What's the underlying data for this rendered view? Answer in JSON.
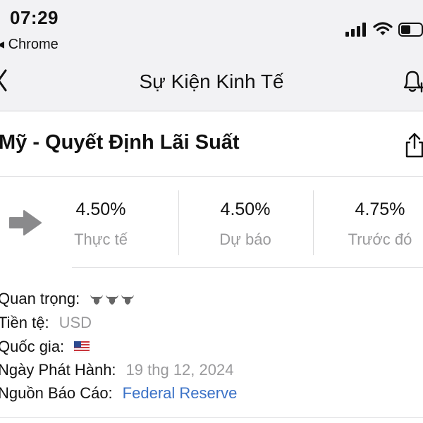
{
  "status_bar": {
    "time": "07:29",
    "back_app": "Chrome"
  },
  "nav": {
    "title": "Sự Kiện Kinh Tế"
  },
  "event": {
    "title": "Mỹ - Quyết Định Lãi Suất"
  },
  "values": {
    "actual": {
      "value": "4.50%",
      "label": "Thực tế"
    },
    "forecast": {
      "value": "4.50%",
      "label": "Dự báo"
    },
    "previous": {
      "value": "4.75%",
      "label": "Trước đó"
    }
  },
  "details": {
    "importance_label": "Quan trọng:",
    "importance_icons": [
      "bull-icon",
      "bull-icon",
      "bull-icon"
    ],
    "currency_label": "Tiền tệ:",
    "currency_value": "USD",
    "country_label": "Quốc gia:",
    "country_flag": "us-flag-icon",
    "release_label": "Ngày Phát Hành:",
    "release_value": "19 thg 12, 2024",
    "source_label": "Nguồn Báo Cáo:",
    "source_value": "Federal Reserve"
  },
  "colors": {
    "link": "#3b72c7",
    "muted": "#9a9a9c",
    "arrow": "#8a8a8c",
    "bar_bg": "#f2f2f4"
  }
}
